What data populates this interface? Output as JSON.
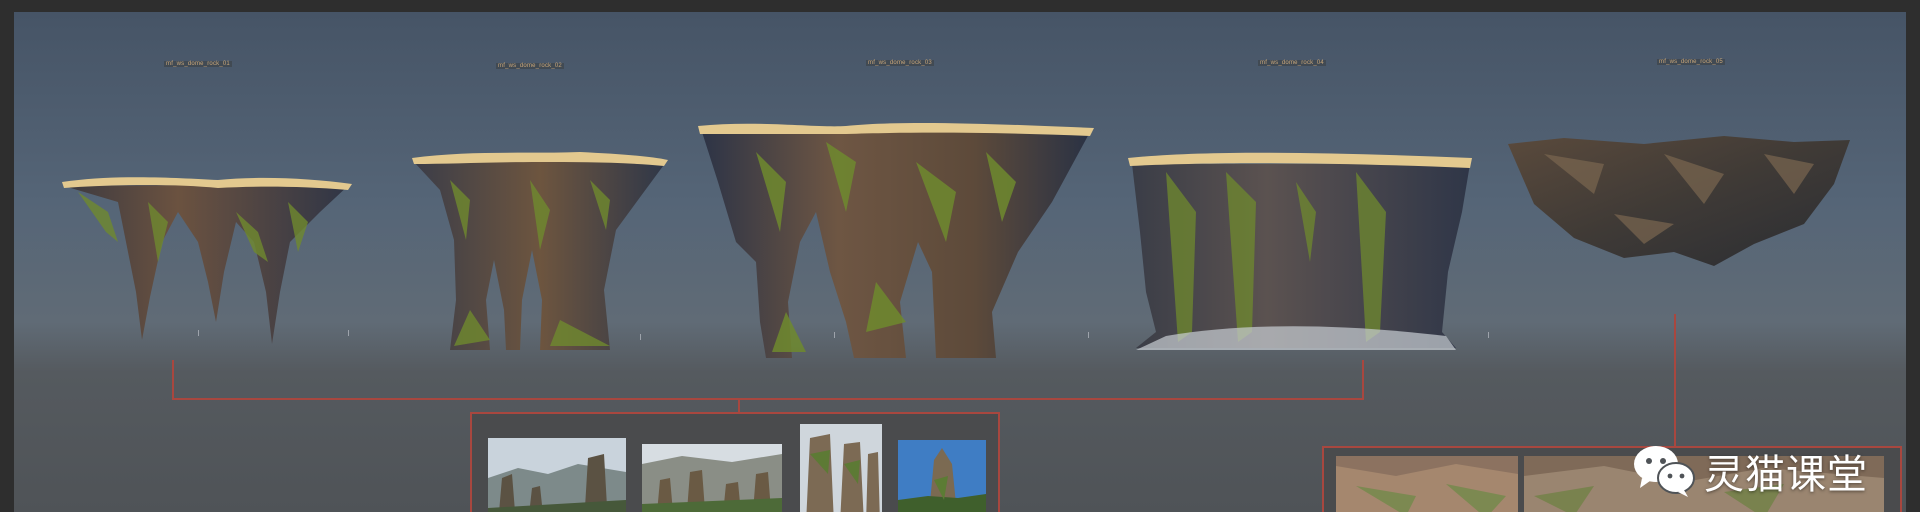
{
  "assets": [
    {
      "label": "mf_ws_dome_rock_01"
    },
    {
      "label": "mf_ws_dome_rock_02"
    },
    {
      "label": "mf_ws_dome_rock_03"
    },
    {
      "label": "mf_ws_dome_rock_04"
    },
    {
      "label": "mf_ws_dome_rock_05"
    }
  ],
  "watermark": {
    "text": "灵猫课堂",
    "icon": "wechat-icon"
  },
  "colors": {
    "connector": "#a8473f",
    "rock_top": "#e3c98f",
    "moss": "#6f8a2e",
    "rock_body": "#5a4a3c"
  }
}
